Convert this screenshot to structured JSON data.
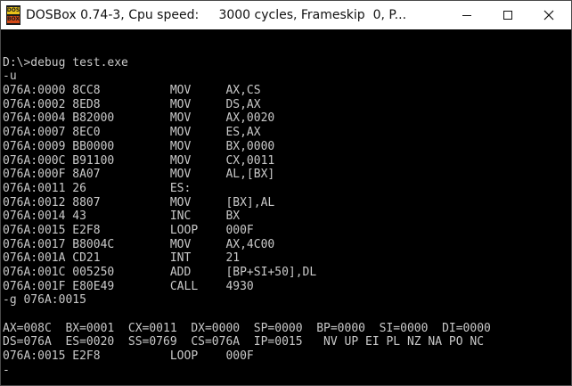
{
  "window": {
    "title": "DOSBox 0.74-3, Cpu speed:     3000 cycles, Frameskip  0, P...",
    "icon_top": "DOS",
    "icon_bottom": "BOX",
    "controls": [
      "minimize-icon",
      "maximize-icon",
      "close-icon"
    ]
  },
  "console": {
    "lines": [
      "",
      "D:\\>debug test.exe",
      "-u",
      "076A:0000 8CC8          MOV     AX,CS",
      "076A:0002 8ED8          MOV     DS,AX",
      "076A:0004 B82000        MOV     AX,0020",
      "076A:0007 8EC0          MOV     ES,AX",
      "076A:0009 BB0000        MOV     BX,0000",
      "076A:000C B91100        MOV     CX,0011",
      "076A:000F 8A07          MOV     AL,[BX]",
      "076A:0011 26            ES:",
      "076A:0012 8807          MOV     [BX],AL",
      "076A:0014 43            INC     BX",
      "076A:0015 E2F8          LOOP    000F",
      "076A:0017 B8004C        MOV     AX,4C00",
      "076A:001A CD21          INT     21",
      "076A:001C 005250        ADD     [BP+SI+50],DL",
      "076A:001F E80E49        CALL    4930",
      "-g 076A:0015",
      "",
      "AX=008C  BX=0001  CX=0011  DX=0000  SP=0000  BP=0000  SI=0000  DI=0000",
      "DS=076A  ES=0020  SS=0769  CS=076A  IP=0015   NV UP EI PL NZ NA PO NC",
      "076A:0015 E2F8          LOOP    000F",
      "-"
    ]
  }
}
